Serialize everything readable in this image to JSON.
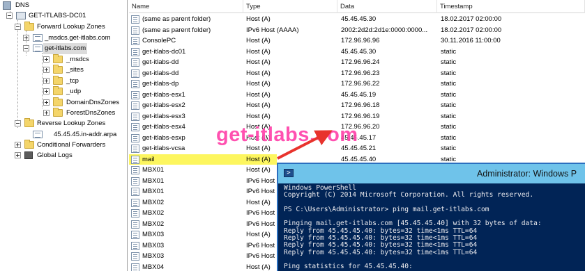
{
  "tree": {
    "root": "DNS",
    "server": "GET-ITLABS-DC01",
    "forward_zones": "Forward Lookup Zones",
    "msdcs_zone": "_msdcs.get-itlabs.com",
    "main_zone": "get-itlabs.com",
    "sub_msdcs": "_msdcs",
    "sub_sites": "_sites",
    "sub_tcp": "_tcp",
    "sub_udp": "_udp",
    "sub_domain_dns": "DomainDnsZones",
    "sub_forest_dns": "ForestDnsZones",
    "reverse_zones": "Reverse Lookup Zones",
    "reverse_zone": "45.45.45.in-addr.arpa",
    "conditional_forwarders": "Conditional Forwarders",
    "global_logs": "Global Logs"
  },
  "list": {
    "columns": [
      "Name",
      "Type",
      "Data",
      "Timestamp"
    ],
    "rows": [
      {
        "name": "(same as parent folder)",
        "type": "Host (A)",
        "data": "45.45.45.30",
        "timestamp": "18.02.2017 02:00:00"
      },
      {
        "name": "(same as parent folder)",
        "type": "IPv6 Host (AAAA)",
        "data": "2002:2d2d:2d1e:0000:0000...",
        "timestamp": "18.02.2017 02:00:00"
      },
      {
        "name": "ConsolePC",
        "type": "Host (A)",
        "data": "172.96.96.96",
        "timestamp": "30.11.2016 11:00:00"
      },
      {
        "name": "get-itlabs-dc01",
        "type": "Host (A)",
        "data": "45.45.45.30",
        "timestamp": "static"
      },
      {
        "name": "get-itlabs-dd",
        "type": "Host (A)",
        "data": "172.96.96.24",
        "timestamp": "static"
      },
      {
        "name": "get-itlabs-dd",
        "type": "Host (A)",
        "data": "172.96.96.23",
        "timestamp": "static"
      },
      {
        "name": "get-itlabs-dp",
        "type": "Host (A)",
        "data": "172.96.96.22",
        "timestamp": "static"
      },
      {
        "name": "get-itlabs-esx1",
        "type": "Host (A)",
        "data": "45.45.45.19",
        "timestamp": "static"
      },
      {
        "name": "get-itlabs-esx2",
        "type": "Host (A)",
        "data": "172.96.96.18",
        "timestamp": "static"
      },
      {
        "name": "get-itlabs-esx3",
        "type": "Host (A)",
        "data": "172.96.96.19",
        "timestamp": "static"
      },
      {
        "name": "get-itlabs-esx4",
        "type": "Host (A)",
        "data": "172.96.96.20",
        "timestamp": "static"
      },
      {
        "name": "get-itlabs-esxp",
        "type": "Host (A)",
        "data": "45.45.45.17",
        "timestamp": "static"
      },
      {
        "name": "get-itlabs-vcsa",
        "type": "Host (A)",
        "data": "45.45.45.21",
        "timestamp": "static"
      },
      {
        "name": "mail",
        "type": "Host (A)",
        "data": "45.45.45.40",
        "timestamp": "static"
      },
      {
        "name": "MBX01",
        "type": "Host (A)",
        "data": "",
        "timestamp": ""
      },
      {
        "name": "MBX01",
        "type": "IPv6 Host",
        "data": "",
        "timestamp": ""
      },
      {
        "name": "MBX01",
        "type": "IPv6 Host",
        "data": "",
        "timestamp": ""
      },
      {
        "name": "MBX02",
        "type": "Host (A)",
        "data": "",
        "timestamp": ""
      },
      {
        "name": "MBX02",
        "type": "IPv6 Host",
        "data": "",
        "timestamp": ""
      },
      {
        "name": "MBX02",
        "type": "IPv6 Host",
        "data": "",
        "timestamp": ""
      },
      {
        "name": "MBX03",
        "type": "Host (A)",
        "data": "",
        "timestamp": ""
      },
      {
        "name": "MBX03",
        "type": "IPv6 Host",
        "data": "",
        "timestamp": ""
      },
      {
        "name": "MBX03",
        "type": "IPv6 Host",
        "data": "",
        "timestamp": ""
      },
      {
        "name": "MBX04",
        "type": "Host (A)",
        "data": "",
        "timestamp": ""
      }
    ]
  },
  "watermark": "get-itlabs.com",
  "powershell": {
    "title": "Administrator: Windows P",
    "lines": [
      "Windows PowerShell",
      "Copyright (C) 2014 Microsoft Corporation. All rights reserved.",
      "",
      "PS C:\\Users\\Administrator> ping mail.get-itlabs.com",
      "",
      "Pinging mail.get-itlabs.com [45.45.45.40] with 32 bytes of data:",
      "Reply from 45.45.45.40: bytes=32 time<1ms TTL=64",
      "Reply from 45.45.45.40: bytes=32 time<1ms TTL=64",
      "Reply from 45.45.45.40: bytes=32 time<1ms TTL=64",
      "Reply from 45.45.45.40: bytes=32 time<1ms TTL=64",
      "",
      "Ping statistics for 45.45.45.40:"
    ]
  },
  "colors": {
    "highlight": "#fdf65f",
    "arrow": "#e8332d",
    "ps_background": "#012456",
    "ps_titlebar": "#6fc3ea",
    "watermark": "#ff3fa8"
  }
}
